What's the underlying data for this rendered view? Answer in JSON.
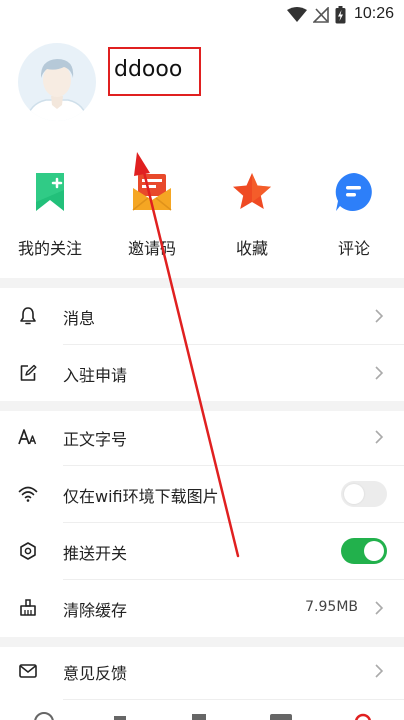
{
  "status_bar": {
    "time": "10:26"
  },
  "profile": {
    "username": "ddooo"
  },
  "quick_actions": [
    {
      "label": "我的关注",
      "icon": "bookmark-plus-icon",
      "color": "#22c07a"
    },
    {
      "label": "邀请码",
      "icon": "envelope-card-icon",
      "color": "#f5a623"
    },
    {
      "label": "收藏",
      "icon": "star-icon",
      "color": "#ef4a23"
    },
    {
      "label": "评论",
      "icon": "comment-bubble-icon",
      "color": "#2d7ff9"
    }
  ],
  "menu": {
    "messages": {
      "label": "消息",
      "icon": "bell-icon"
    },
    "settle_apply": {
      "label": "入驻申请",
      "icon": "edit-icon"
    },
    "font_size": {
      "label": "正文字号",
      "icon": "font-size-icon"
    },
    "wifi_images": {
      "label": "仅在wifi环境下载图片",
      "icon": "wifi-icon",
      "enabled": false
    },
    "push": {
      "label": "推送开关",
      "icon": "hexagon-icon",
      "enabled": true
    },
    "clear_cache": {
      "label": "清除缓存",
      "icon": "broom-icon",
      "value": "7.95MB"
    },
    "feedback": {
      "label": "意见反馈",
      "icon": "mail-icon"
    }
  },
  "colors": {
    "toggle_on": "#22b14c",
    "toggle_off": "#ececec",
    "annotation_red": "#e02020",
    "separator": "#f3f3f3"
  }
}
